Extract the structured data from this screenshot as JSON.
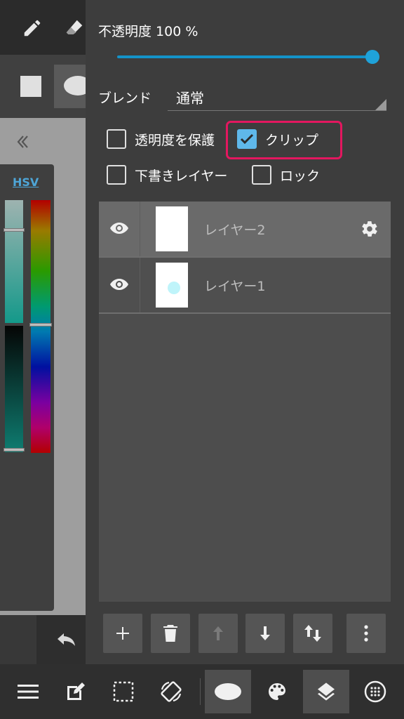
{
  "opacity": {
    "label": "不透明度 100 %",
    "value_percent": 100
  },
  "blend": {
    "label": "ブレンド",
    "value": "通常"
  },
  "checkboxes": {
    "protect_alpha": {
      "label": "透明度を保護",
      "checked": false
    },
    "clip": {
      "label": "クリップ",
      "checked": true
    },
    "draft": {
      "label": "下書きレイヤー",
      "checked": false
    },
    "lock": {
      "label": "ロック",
      "checked": false
    }
  },
  "layers": [
    {
      "name": "レイヤー2",
      "selected": true,
      "visible": true
    },
    {
      "name": "レイヤー1",
      "selected": false,
      "visible": true
    }
  ],
  "color_panel": {
    "mode_label": "HSV"
  },
  "colors": {
    "accent": "#1fa2d9",
    "highlight": "#e3175f",
    "checkbox_on": "#5fb8ea",
    "layer_dot": "#bff4fa"
  },
  "icons": {
    "top_tools": [
      "pencil-icon",
      "eraser-icon"
    ],
    "shape_tools": [
      "rectangle-icon",
      "ellipse-icon"
    ],
    "panel_actions": [
      "plus-icon",
      "trash-icon",
      "arrow-up-icon",
      "arrow-down-icon",
      "swap-vertical-icon",
      "more-vertical-icon"
    ],
    "bottom_bar": [
      "menu-icon",
      "edit-icon",
      "selection-icon",
      "rotate-icon",
      "ellipse-brush-icon",
      "palette-icon",
      "layers-icon",
      "material-icon"
    ]
  }
}
